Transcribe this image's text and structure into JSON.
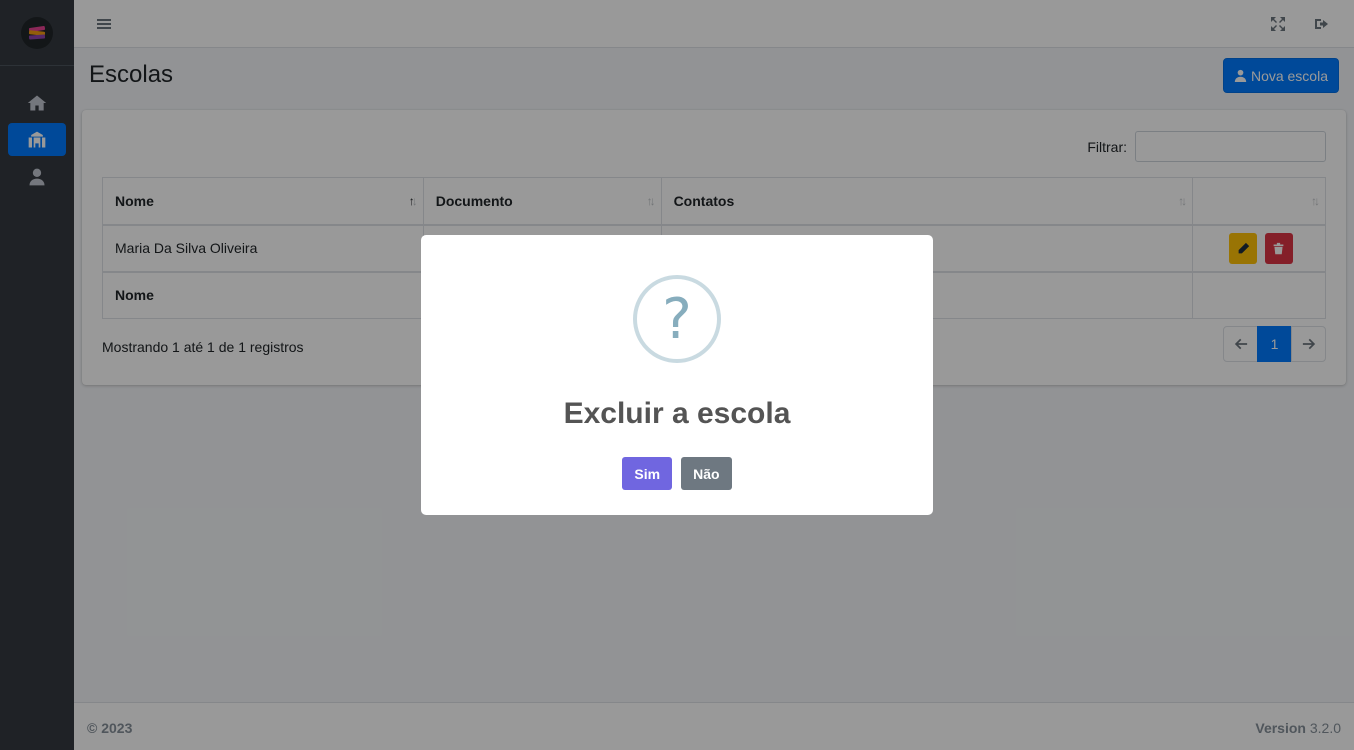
{
  "page": {
    "title": "Escolas",
    "new_button": "Nova escola"
  },
  "filter": {
    "label": "Filtrar:",
    "value": ""
  },
  "table": {
    "headers": [
      "Nome",
      "Documento",
      "Contatos",
      ""
    ],
    "rows": [
      {
        "nome": "Maria Da Silva Oliveira",
        "documento": "",
        "contatos": ""
      }
    ],
    "footer": [
      "Nome",
      "",
      "",
      ""
    ]
  },
  "info": "Mostrando 1 até 1 de 1 registros",
  "pagination": {
    "current": "1"
  },
  "footer": {
    "copyright": "© 2023",
    "version_label": "Version",
    "version_number": "3.2.0"
  },
  "modal": {
    "icon": "?",
    "title": "Excluir a escola",
    "confirm": "Sim",
    "cancel": "Não"
  },
  "colors": {
    "sidebar": "#343a40",
    "primary": "#007bff",
    "warning": "#ffc107",
    "danger": "#dc3545",
    "confirm": "#7066e0",
    "cancel": "#6e7881"
  },
  "icons": {
    "brand": "logo-icon",
    "nav": [
      "home-icon",
      "school-icon",
      "user-icon"
    ],
    "topbar": [
      "menu-icon",
      "fullscreen-icon",
      "logout-icon"
    ],
    "row_actions": [
      "pencil-icon",
      "trash-icon"
    ]
  }
}
